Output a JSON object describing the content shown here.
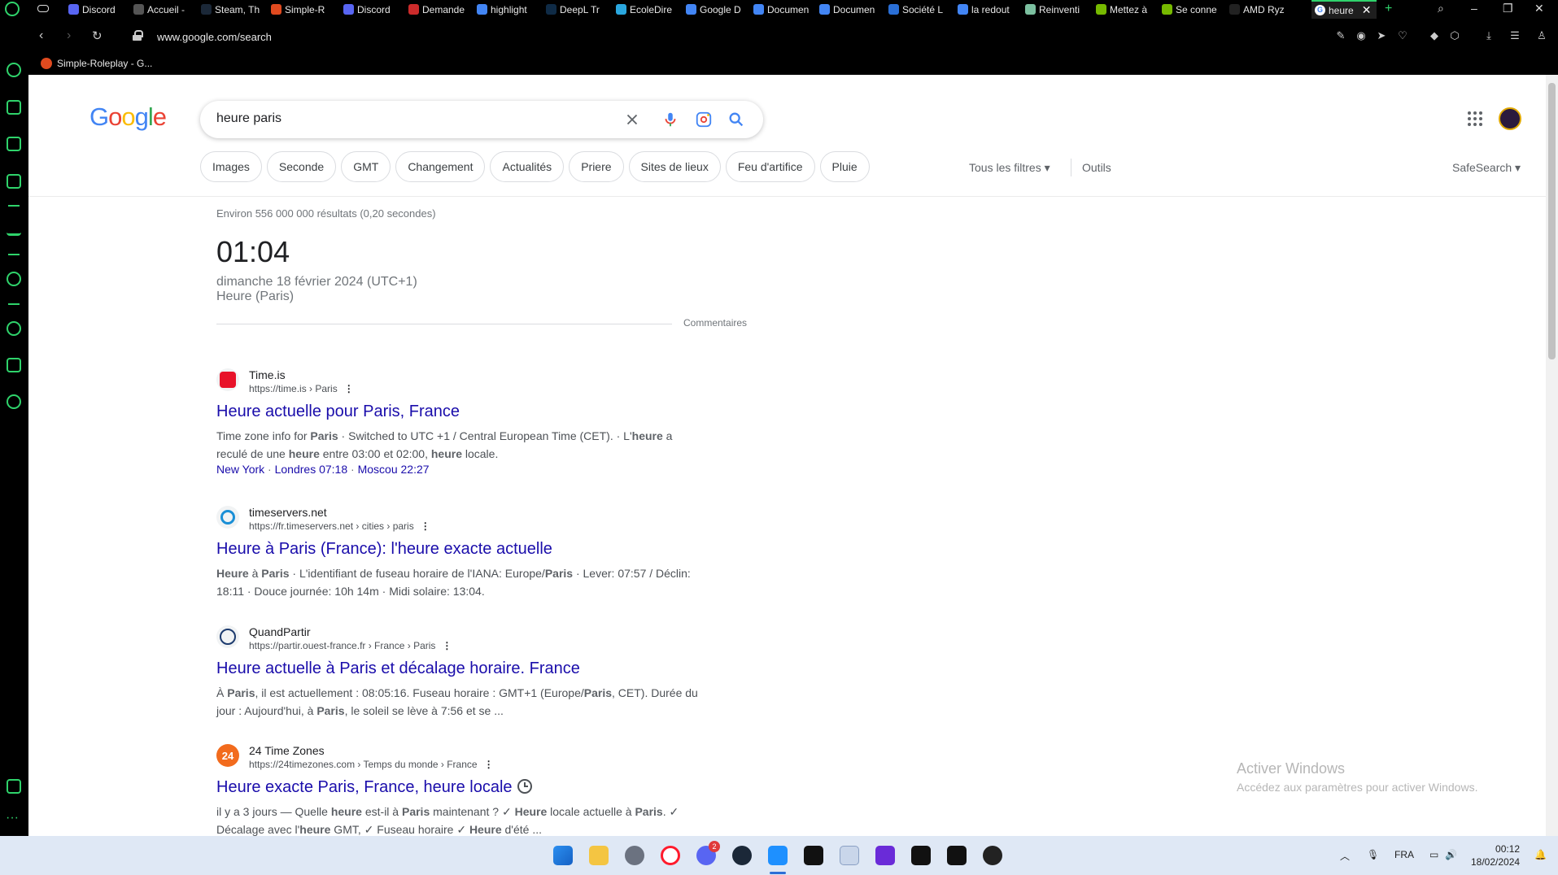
{
  "browser": {
    "tabs": [
      {
        "label": "Discord",
        "color": "#5865f2"
      },
      {
        "label": "Accueil -",
        "color": "#555555"
      },
      {
        "label": "Steam, Th",
        "color": "#1b2838"
      },
      {
        "label": "Simple-R",
        "color": "#e04a1f"
      },
      {
        "label": "Discord",
        "color": "#5865f2"
      },
      {
        "label": "Demande",
        "color": "#cc2b2b"
      },
      {
        "label": "highlight",
        "color": "#4285f4"
      },
      {
        "label": "DeepL Tr",
        "color": "#0f2b46"
      },
      {
        "label": "EcoleDire",
        "color": "#2aa7df"
      },
      {
        "label": "Google D",
        "color": "#4285f4"
      },
      {
        "label": "Documen",
        "color": "#4285f4"
      },
      {
        "label": "Documen",
        "color": "#4285f4"
      },
      {
        "label": "Société L",
        "color": "#2a6fd6"
      },
      {
        "label": "la redout",
        "color": "#4285f4"
      },
      {
        "label": "Reinventi",
        "color": "#7cc0a0"
      },
      {
        "label": "Mettez à",
        "color": "#76b900"
      },
      {
        "label": "Se conne",
        "color": "#76b900"
      },
      {
        "label": "AMD Ryz",
        "color": "#222222"
      }
    ],
    "active_tab": {
      "label": "heure",
      "close_glyph": "✕"
    },
    "new_tab_glyph": "+",
    "url": "www.google.com/search",
    "bookmark": "Simple-Roleplay - G..."
  },
  "search": {
    "logo_letters": [
      "G",
      "o",
      "o",
      "g",
      "l",
      "e"
    ],
    "query": "heure paris",
    "chips": [
      "Images",
      "Seconde",
      "GMT",
      "Changement",
      "Actualités",
      "Priere",
      "Sites de lieux",
      "Feu d'artifice",
      "Pluie"
    ],
    "all_filters": "Tous les filtres",
    "tools": "Outils",
    "safesearch": "SafeSearch"
  },
  "answer": {
    "stats": "Environ 556 000 000 résultats (0,20 secondes)",
    "time": "01:04",
    "date": "dimanche 18 février 2024 (UTC+1)",
    "zone": "Heure (Paris)",
    "feedback": "Commentaires"
  },
  "results": [
    {
      "site": "Time.is",
      "url": "https://time.is › Paris",
      "title": "Heure actuelle pour Paris, France",
      "desc_parts": [
        [
          "Time zone info for ",
          false
        ],
        [
          "Paris",
          true
        ],
        [
          " · Switched to UTC +1 / Central European Time (CET). · L'",
          false
        ],
        [
          "heure",
          true
        ],
        [
          " a reculé de une ",
          false
        ],
        [
          "heure",
          true
        ],
        [
          " entre 03:00 et 02:00, ",
          false
        ],
        [
          "heure",
          true
        ],
        [
          " locale.",
          false
        ]
      ],
      "links": [
        "New York",
        "Londres 07:18",
        "Moscou 22:27"
      ]
    },
    {
      "site": "timeservers.net",
      "url": "https://fr.timeservers.net › cities › paris",
      "title": "Heure à Paris (France): l'heure exacte actuelle",
      "desc_parts": [
        [
          "Heure",
          true
        ],
        [
          " à ",
          false
        ],
        [
          "Paris",
          true
        ],
        [
          " · L'identifiant de fuseau horaire de l'IANA: Europe/",
          false
        ],
        [
          "Paris",
          true
        ],
        [
          " · Lever: 07:57 / Déclin: 18:11 · Douce journée: 10h 14m · Midi solaire: 13:04.",
          false
        ]
      ],
      "links": []
    },
    {
      "site": "QuandPartir",
      "url": "https://partir.ouest-france.fr › France › Paris",
      "title": "Heure actuelle à Paris et décalage horaire. France",
      "desc_parts": [
        [
          "À ",
          false
        ],
        [
          "Paris",
          true
        ],
        [
          ", il est actuellement : 08:05:16. Fuseau horaire : GMT+1 (Europe/",
          false
        ],
        [
          "Paris",
          true
        ],
        [
          ", CET). Durée du jour : Aujourd'hui, à ",
          false
        ],
        [
          "Paris",
          true
        ],
        [
          ", le soleil se lève à 7:56 et se ...",
          false
        ]
      ],
      "links": []
    },
    {
      "site": "24 Time Zones",
      "url": "https://24timezones.com › Temps du monde › France",
      "title": "Heure exacte Paris, France, heure locale",
      "desc_parts": [
        [
          "il y a 3 jours — Quelle ",
          false
        ],
        [
          "heure",
          true
        ],
        [
          " est-il à ",
          false
        ],
        [
          "Paris",
          true
        ],
        [
          " maintenant ? ✓ ",
          false
        ],
        [
          "Heure",
          true
        ],
        [
          " locale actuelle à ",
          false
        ],
        [
          "Paris",
          true
        ],
        [
          ". ✓ Décalage avec l'",
          false
        ],
        [
          "heure",
          true
        ],
        [
          " GMT, ✓ Fuseau horaire ✓ ",
          false
        ],
        [
          "Heure",
          true
        ],
        [
          " d'été ...",
          false
        ]
      ],
      "links": []
    }
  ],
  "result_favicon_text": "24",
  "windows_watermark": {
    "title": "Activer Windows",
    "subtitle": "Accédez aux paramètres pour activer Windows."
  },
  "taskbar": {
    "language": "FRA",
    "time": "00:12",
    "date": "18/02/2024",
    "discord_badge": "2"
  }
}
